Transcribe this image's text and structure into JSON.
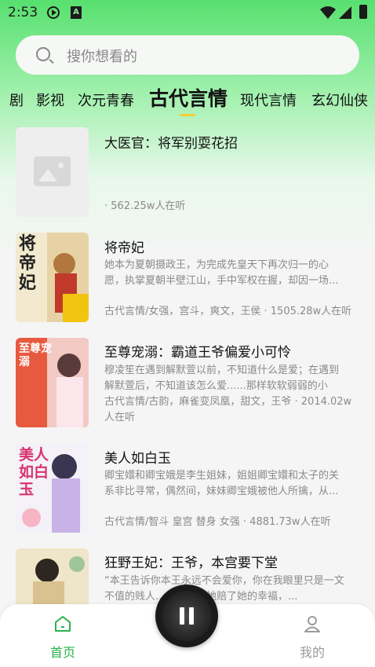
{
  "status_bar": {
    "time": "2:53"
  },
  "search": {
    "placeholder": "搜你想看的"
  },
  "tabs": [
    "剧",
    "影视",
    "次元青春",
    "古代言情",
    "现代言情",
    "玄幻仙侠"
  ],
  "active_tab": "古代言情",
  "books": [
    {
      "title": "大医官：将军别耍花招",
      "desc": "",
      "meta": "· 562.25w人在听"
    },
    {
      "title": "将帝妃",
      "desc": "她本为夏朝摄政王，为完成先皇天下再次归一的心愿，执掌夏朝半壁江山，手中军权在握，却因一场...",
      "meta": "古代言情/女强，宫斗，爽文，王侯 · 1505.28w人在听"
    },
    {
      "title": "至尊宠溺：霸道王爷偏爱小可怜",
      "desc": "穆凌笙在遇到解默萱以前，不知道什么是爱；在遇到解默萱后，不知道该怎么爱......那样软软弱弱的小人...",
      "meta": "古代言情/古韵，麻雀变凤凰，甜文，王爷 · 2014.02w人在听"
    },
    {
      "title": "美人如白玉",
      "desc": "卿宝嬛和卿宝娥是李生姐妹，姐姐卿宝嬛和太子的关系非比寻常，偶然间，妹妹卿宝娥被他人所擒，从...",
      "meta": "古代言情/智斗 皇宫 替身 女强 · 4881.73w人在听"
    },
    {
      "title": "狂野王妃：王爷，本宫要下堂",
      "desc": "“本王告诉你本王永远不会爱你，你在我眼里只是一文不值的贱人……贱人？她赔了她的幸福，...",
      "meta": ""
    }
  ],
  "cover_texts": [
    "将帝妃",
    "至尊宠溺",
    "美人如白玉"
  ],
  "bottom_nav": {
    "home": "首页",
    "me": "我的"
  },
  "colors": {
    "accent": "#2bb24c",
    "indicator": "#f3cf35"
  }
}
